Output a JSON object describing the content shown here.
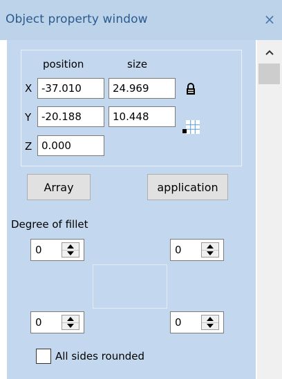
{
  "window": {
    "title": "Object property window",
    "close_symbol": "×"
  },
  "transform": {
    "position_header": "position",
    "size_header": "size",
    "x_label": "X",
    "y_label": "Y",
    "z_label": "Z",
    "x_value": "-37.010",
    "y_value": "-20.188",
    "z_value": "0.000",
    "width_value": "24.969",
    "height_value": "10.448"
  },
  "buttons": {
    "array_label": "Array",
    "application_label": "application"
  },
  "fillet": {
    "label": "Degree of fillet",
    "top_left": "0",
    "top_right": "0",
    "bottom_left": "0",
    "bottom_right": "0",
    "all_sides_label": "All sides rounded",
    "all_sides_checked": false
  },
  "colors": {
    "panel_bg": "#c3d8ee",
    "title_bar_bg": "#bcd3ea",
    "title_text": "#2b5a8e"
  }
}
